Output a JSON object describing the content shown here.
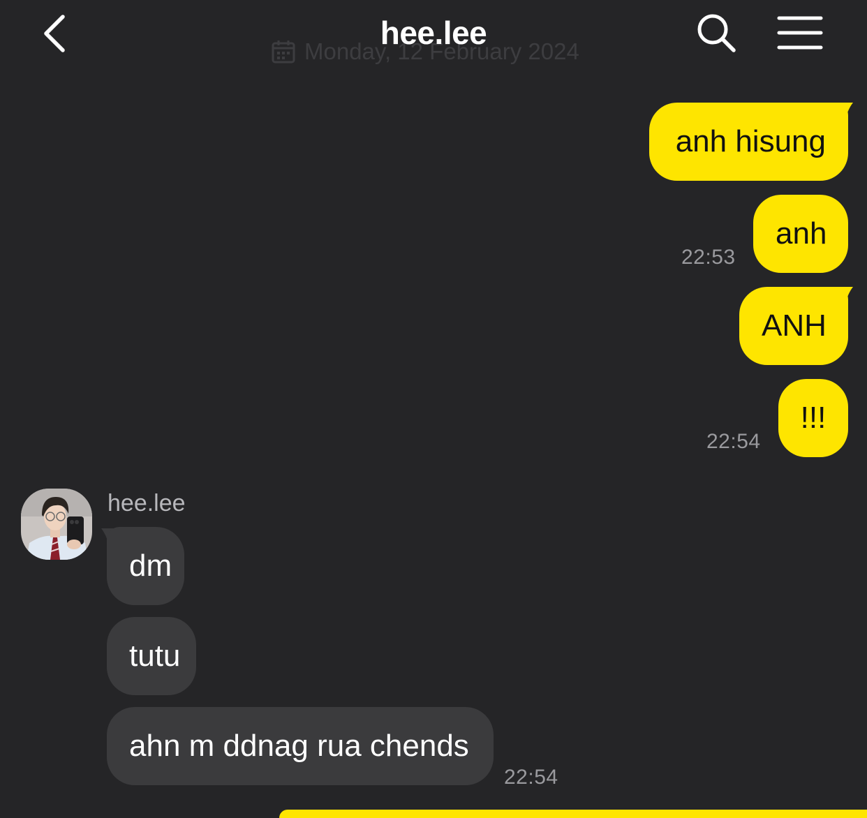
{
  "header": {
    "title": "hee.lee",
    "date_watermark": "Monday, 12 February 2024"
  },
  "theme": {
    "background": "#252527",
    "outgoing_bubble": "#fee500",
    "incoming_bubble": "#3b3b3d"
  },
  "icons": {
    "back": "chevron-left-icon",
    "search": "search-icon",
    "menu": "menu-icon",
    "calendar": "calendar-icon"
  },
  "messages_out": [
    {
      "text": "anh hisung"
    },
    {
      "text": "anh",
      "time": "22:53"
    },
    {
      "text": "ANH"
    },
    {
      "text": "!!!",
      "time": "22:54"
    }
  ],
  "incoming": {
    "sender": "hee.lee",
    "messages": [
      {
        "text": "dm"
      },
      {
        "text": "tutu"
      },
      {
        "text": "ahn m ddnag rua chends",
        "time": "22:54"
      }
    ]
  }
}
